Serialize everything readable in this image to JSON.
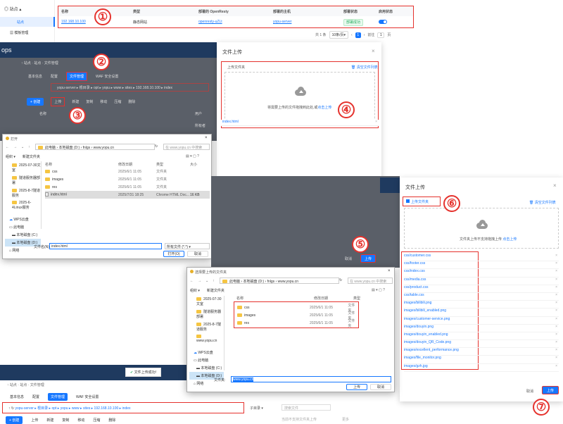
{
  "top": {
    "side_section": "站点",
    "side_item_active": "站点",
    "side_item_2": "模板管理",
    "headers": [
      "名称",
      "类型",
      "部署的 OpenResty",
      "部署的主机",
      "部署状态",
      "启用状态"
    ],
    "row": [
      "192.168.10.100",
      "静态网站",
      "openresty-uZLt",
      "yopu-server",
      "部署成功"
    ],
    "pagination": {
      "total": "共 1 条",
      "size": "10条/页",
      "page": "1",
      "goto": "前往",
      "pg": "1",
      "unit": "页"
    }
  },
  "mid": {
    "brand": "ops",
    "crumbs": "↑ 站点  ·  站点  ·  文件管理",
    "tabs": [
      "基本信息",
      "配置",
      "文件管理",
      "WAF 安全设置"
    ],
    "path": "yopu-server ▸ 根目录 ▸ opt ▸ yopu ▸ www ▸ sites ▸ 192.168.10.100 ▸ index",
    "toolbar": [
      "+ 创建",
      "上传",
      "新建",
      "复制",
      "移动",
      "压缩",
      "删除"
    ],
    "col_name": "名称",
    "col_user": "用户",
    "col_user_val": "所有者"
  },
  "d1": {
    "title": "文件上传",
    "upload_tab": "上传文件夹",
    "clear": "清空文件列表",
    "hint": "将需要上传的文件拖拽到此处,或",
    "hint_link": "点击上传",
    "file": "index.html"
  },
  "w1": {
    "title": "打开",
    "addr": "此电脑 › 本地磁盘 (D:) › fnlgs › www.yopu.cn",
    "search": "在 www.yopu.cn 中搜索",
    "org": "组织 ▾",
    "newf": "新建文件夹",
    "tree": [
      "2025-07-30文室",
      "隧道服务器部署",
      "2025-8-7隧道服务",
      "2025-6-4Linux服务"
    ],
    "tree2": [
      "WPS云盘",
      "此电脑",
      "本地磁盘 (C:)",
      "本地磁盘 (D:)",
      "网络"
    ],
    "cols": [
      "名称",
      "修改日期",
      "类型",
      "大小"
    ],
    "files": [
      [
        "css",
        "2025/6/1 11:05",
        "文件夹",
        ""
      ],
      [
        "images",
        "2025/6/1 11:05",
        "文件夹",
        ""
      ],
      [
        "res",
        "2025/6/1 11:05",
        "文件夹",
        ""
      ],
      [
        "index.html",
        "2025/7/31 18:25",
        "Chrome HTML Doc...",
        "16 KB"
      ]
    ],
    "fname_label": "文件名(N):",
    "fname": "index.html",
    "ftype": "所有文件 (*.*)",
    "open": "打开(O)",
    "cancel": "取消"
  },
  "d2": {
    "title": "文件上传",
    "upload_tab": "上传文件夹",
    "clear": "清空文件列表",
    "hint": "文件夹上传不支持拖拽上传",
    "hint_link": "点击上传",
    "files": [
      "css/customer.css",
      "css/footer.css",
      "css/index.css",
      "css/media.css",
      "css/product.css",
      "css/table.css",
      "images/bilibili.png",
      "images/bilibili_enabled.png",
      "images/customer-service.png",
      "images/douyin.png",
      "images/douyin_enabled.png",
      "images/douyin_QR_Code.png",
      "images/excellent_performance.png",
      "images/file_monitor.png",
      "images/gzh.jpg"
    ],
    "cancel": "取消",
    "upload": "上传"
  },
  "cancel5": "取消",
  "upload5": "上传",
  "w2": {
    "title": "选择要上传的文件夹",
    "addr": "此电脑 › 本地磁盘 (D:) › fnlgs › www.yopu.cn",
    "search": "在 www.yopu.cn 中搜索",
    "org": "组织 ▾",
    "newf": "新建文件夹",
    "tree": [
      "2025-07-30文室",
      "隧道服务器部署",
      "2025-8-7隧道服务",
      "www.yopu.cn"
    ],
    "tree2": [
      "WPS云盘",
      "此电脑",
      "本地磁盘 (C:)",
      "本地磁盘 (D:)",
      "网络"
    ],
    "cols": [
      "名称",
      "修改日期",
      "类型"
    ],
    "files": [
      [
        "css",
        "2025/6/1 11:05",
        "文件夹"
      ],
      [
        "images",
        "2025/6/1 11:05",
        "文件夹"
      ],
      [
        "res",
        "2025/6/1 11:05",
        "文件夹"
      ]
    ],
    "fname_label": "文件夹:",
    "fname": "www.yopu.cn",
    "select": "上传",
    "cancel": "取消"
  },
  "bot": {
    "toast": "文件上传成功!",
    "crumbs": "↑ 站点  ·  站点  ·  文件管理",
    "tabs": [
      "基本信息",
      "配置",
      "文件管理",
      "WAF 安全设置"
    ],
    "path": "yopu-server ▸ 根目录 ▸ opt ▸ yopu ▸ www ▸ sites ▸ 192.168.10.100 ▸ index",
    "toolbar": [
      "+ 创建",
      "上传",
      "新建",
      "复制",
      "移动",
      "压缩",
      "删除"
    ],
    "search": "子目录",
    "filter": "搜索文件",
    "partial_hint": "当前不支持文件夹上传",
    "more": "更多"
  },
  "steps": [
    "①",
    "②",
    "③",
    "④",
    "⑤",
    "⑥",
    "⑦"
  ],
  "colors": {
    "accent": "#1677ff",
    "marker": "#e5322d",
    "dark_header": "#1f3a5f"
  }
}
